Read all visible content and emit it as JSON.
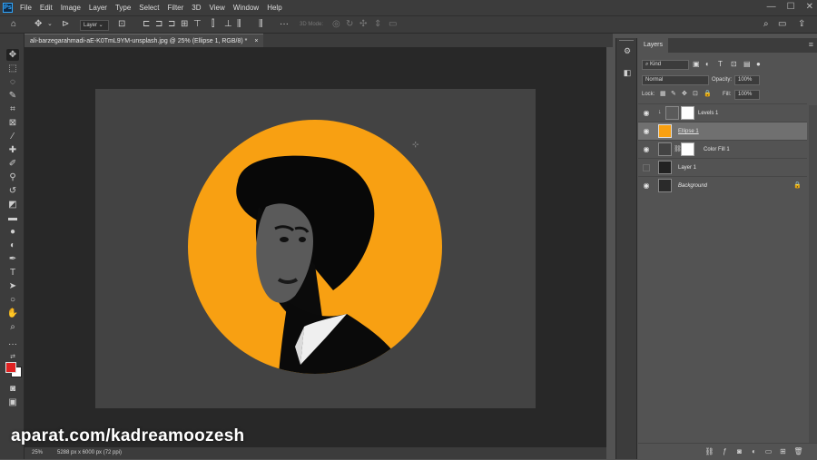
{
  "menu": {
    "logo": "Ps",
    "items": [
      "File",
      "Edit",
      "Image",
      "Layer",
      "Type",
      "Select",
      "Filter",
      "3D",
      "View",
      "Window",
      "Help"
    ],
    "window_controls": [
      "—",
      "☐",
      "✕"
    ]
  },
  "options_bar": {
    "auto_select_target": "Layer",
    "mode_3d_label": "3D Mode:"
  },
  "document": {
    "tab_title": "ali-barzegarahmadi-aE-K0TmL9YM-unsplash.jpg @ 25% (Ellipse 1, RGB/8) *",
    "tab_close": "×"
  },
  "status": {
    "zoom": "25%",
    "doc_info": "5288 px x 6000 px (72 ppi)"
  },
  "watermark": "aparat.com/kadreamoozesh",
  "layers_panel": {
    "title": "Layers",
    "filter_kind": "Kind",
    "blend_mode": "Normal",
    "opacity_label": "Opacity:",
    "opacity_value": "100%",
    "lock_label": "Lock:",
    "fill_label": "Fill:",
    "fill_value": "100%",
    "layers": [
      {
        "name": "Levels 1",
        "visible": true,
        "selected": false,
        "italic": false
      },
      {
        "name": "Ellipse 1",
        "visible": true,
        "selected": true,
        "italic": false
      },
      {
        "name": "Color Fill 1",
        "visible": true,
        "selected": false,
        "italic": false
      },
      {
        "name": "Layer 1",
        "visible": false,
        "selected": false,
        "italic": false
      },
      {
        "name": "Background",
        "visible": true,
        "selected": false,
        "italic": true,
        "locked": true
      }
    ]
  },
  "colors": {
    "accent_orange": "#f8a012",
    "foreground_swatch": "#e02222",
    "background_swatch": "#ffffff"
  }
}
